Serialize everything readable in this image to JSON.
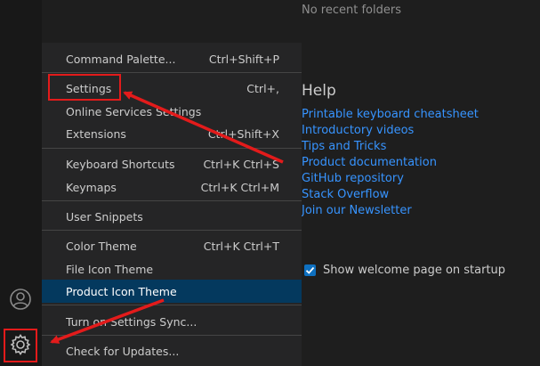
{
  "welcome": {
    "recent_empty": "No recent folders",
    "help_heading": "Help",
    "help_links": [
      "Printable keyboard cheatsheet",
      "Introductory videos",
      "Tips and Tricks",
      "Product documentation",
      "GitHub repository",
      "Stack Overflow",
      "Join our Newsletter"
    ],
    "startup_checkbox_label": "Show welcome page on startup",
    "startup_checked": true
  },
  "menu": {
    "items": [
      {
        "label": "Command Palette...",
        "shortcut": "Ctrl+Shift+P"
      },
      {
        "label": "Settings",
        "shortcut": "Ctrl+,"
      },
      {
        "label": "Online Services Settings",
        "shortcut": ""
      },
      {
        "label": "Extensions",
        "shortcut": "Ctrl+Shift+X"
      },
      {
        "label": "Keyboard Shortcuts",
        "shortcut": "Ctrl+K Ctrl+S"
      },
      {
        "label": "Keymaps",
        "shortcut": "Ctrl+K Ctrl+M"
      },
      {
        "label": "User Snippets",
        "shortcut": ""
      },
      {
        "label": "Color Theme",
        "shortcut": "Ctrl+K Ctrl+T"
      },
      {
        "label": "File Icon Theme",
        "shortcut": ""
      },
      {
        "label": "Product Icon Theme",
        "shortcut": ""
      },
      {
        "label": "Turn on Settings Sync...",
        "shortcut": ""
      },
      {
        "label": "Check for Updates...",
        "shortcut": ""
      }
    ],
    "highlighted_item": "Product Icon Theme"
  },
  "activity_bar": {
    "icons": [
      "account-icon",
      "manage-gear-icon"
    ]
  },
  "colors": {
    "annotation": "#e31b1b",
    "link": "#3794ff",
    "highlight": "#04395e"
  }
}
